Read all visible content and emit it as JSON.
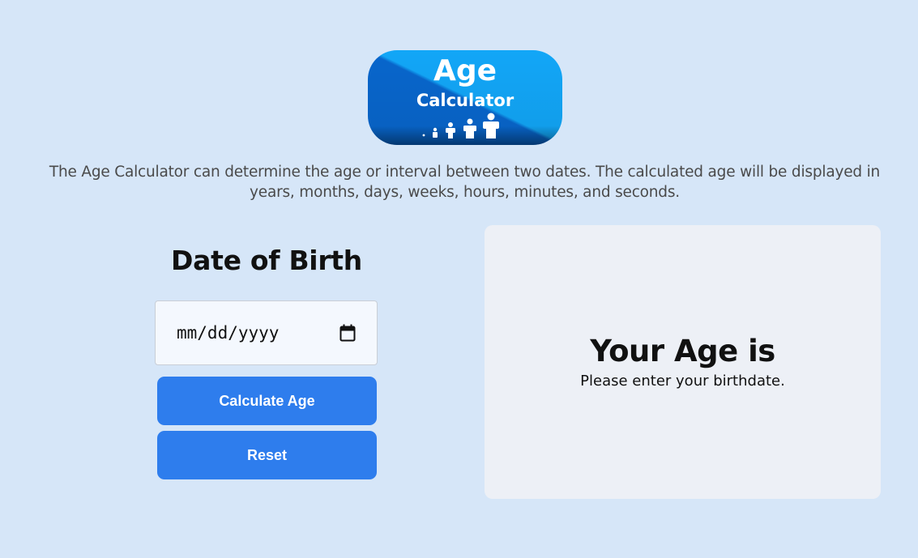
{
  "logo": {
    "line1": "Age",
    "line2": "Calculator",
    "colors": [
      "#0a58c4",
      "#14a4f6",
      "#ffffff"
    ]
  },
  "intro": {
    "text": "The Age Calculator can determine the age or interval between two dates. The calculated age will be displayed in years, months, days, weeks, hours, minutes, and seconds."
  },
  "form": {
    "title": "Date of Birth",
    "date_placeholder": "mm/dd/yyyy",
    "calculate_label": "Calculate Age",
    "reset_label": "Reset",
    "button_color": "#2e7ded"
  },
  "result": {
    "title": "Your Age is",
    "message": "Please enter your birthdate."
  },
  "colors": {
    "page_background": "#d6e6f8",
    "card_background": "#edf0f6"
  }
}
